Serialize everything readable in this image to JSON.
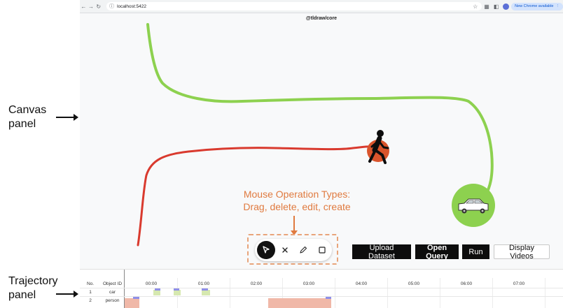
{
  "annotations": {
    "canvas_label_line1": "Canvas",
    "canvas_label_line2": "panel",
    "trajectory_label_line1": "Trajectory",
    "trajectory_label_line2": "panel",
    "mouse_ops_line1": "Mouse Operation Types:",
    "mouse_ops_line2": "Drag, delete, edit, create"
  },
  "browser": {
    "url": "localhost:5422",
    "update_label": "New Chrome available",
    "nav_icons": [
      "back-arrow-icon",
      "forward-arrow-icon",
      "reload-icon",
      "info-icon"
    ],
    "toolbar_icons": [
      "star-icon",
      "extension-icon",
      "sidebar-icon",
      "profile-icon",
      "menu-dots-icon"
    ]
  },
  "canvas": {
    "watermark": "@tldraw/core",
    "paths": [
      {
        "name": "green-trajectory",
        "color": "#8dd14f"
      },
      {
        "name": "red-trajectory",
        "color": "#d93a2e"
      }
    ],
    "objects": [
      {
        "name": "pedestrian",
        "icon": "walking-person-icon",
        "badge_color": "#d9542c"
      },
      {
        "name": "car",
        "icon": "car-icon",
        "badge_color": "#8dd14f"
      }
    ]
  },
  "toolbar": {
    "tools": [
      {
        "name": "select",
        "icon": "cursor-icon",
        "active": true
      },
      {
        "name": "delete",
        "icon": "x-icon",
        "active": false
      },
      {
        "name": "edit",
        "icon": "pencil-icon",
        "active": false
      },
      {
        "name": "create",
        "icon": "rectangle-icon",
        "active": false
      }
    ]
  },
  "actions": {
    "upload": "Upload Dataset",
    "open_query": "Open Query",
    "run": "Run",
    "display_videos": "Display Videos"
  },
  "trajectory_panel": {
    "columns": [
      "No.",
      "Object ID"
    ],
    "time_ticks": [
      "00:00",
      "01:00",
      "02:00",
      "03:00",
      "04:00",
      "05:00",
      "06:00",
      "07:00"
    ],
    "rows": [
      {
        "no": "1",
        "object_id": "car"
      },
      {
        "no": "2",
        "object_id": "person"
      }
    ],
    "segment_colors": {
      "car": "#d6e8b0",
      "person": "#f0b8a8",
      "marker": "#8f8fe8"
    }
  }
}
